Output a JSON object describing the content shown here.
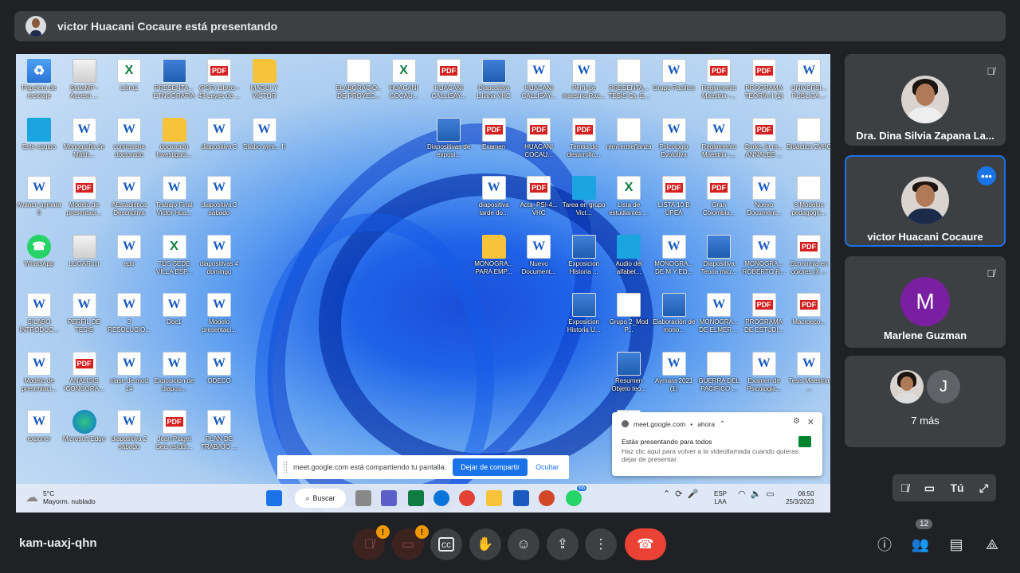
{
  "banner": {
    "text": "victor Huacani Cocaure está presentando"
  },
  "desktop_icons": [
    {
      "label": "Papelera de reciclaje",
      "type": "R"
    },
    {
      "label": "StataMP - Acceso ...",
      "type": "G"
    },
    {
      "label": "Libro1",
      "type": "X"
    },
    {
      "label": "PRESENTA... ETNOGRAFIA",
      "type": "I"
    },
    {
      "label": "(PDF) Libros - 43 Leyes de ...",
      "type": "P"
    },
    {
      "label": "MAGUI Y VICTOR",
      "type": "F"
    },
    {
      "label": "ELABORACIÓ... DE PROYEC...",
      "type": "T"
    },
    {
      "label": "HUACANI COCAU...",
      "type": "X"
    },
    {
      "label": "HUACANI CALLISAY...",
      "type": "P"
    },
    {
      "label": "Diapositiva Liliana VHC",
      "type": "I"
    },
    {
      "label": "HUACANI CALLISAY...",
      "type": "W"
    },
    {
      "label": "Perfil de maestria Rac...",
      "type": "W"
    },
    {
      "label": "PRESENTA... TESIS Cs. E...",
      "type": "T"
    },
    {
      "label": "Grupo Pacifico",
      "type": "W"
    },
    {
      "label": "Reglamento Maestria -...",
      "type": "P"
    },
    {
      "label": "PROGRAMA TEORIA II (1)",
      "type": "P"
    },
    {
      "label": "UNIVERSI... PUBLICA ...",
      "type": "W"
    },
    {
      "label": "Este equipo",
      "type": "C"
    },
    {
      "label": "Monografia de Matth...",
      "type": "W"
    },
    {
      "label": "contrasena doctorado",
      "type": "W"
    },
    {
      "label": "doctorado Investigaci...",
      "type": "F"
    },
    {
      "label": "diapositiva 3",
      "type": "W"
    },
    {
      "label": "Silabo aym... II",
      "type": "W"
    },
    {
      "label": "Diapositivas de exposi...",
      "type": "I"
    },
    {
      "label": "Examen",
      "type": "P"
    },
    {
      "label": "HUACANI COCAU...",
      "type": "P"
    },
    {
      "label": "Temas de desarrollo...",
      "type": "P"
    },
    {
      "label": "remi enseñanza",
      "type": "T"
    },
    {
      "label": "Psicologia Evolutiva",
      "type": "W"
    },
    {
      "label": "Reglamento Maestria -...",
      "type": "W"
    },
    {
      "label": "Burke, la re... ANNALES ...",
      "type": "P"
    },
    {
      "label": "Didáctica 2VHC",
      "type": "T"
    },
    {
      "label": "Avance aymara II",
      "type": "W"
    },
    {
      "label": "Modelo de presentaci...",
      "type": "P"
    },
    {
      "label": "AEstadistica Descriptiva",
      "type": "W"
    },
    {
      "label": "Trabajo Final Victor Hua...",
      "type": "W"
    },
    {
      "label": "diapositiva 3 sabado",
      "type": "W"
    },
    {
      "label": "diapositiva tarde do...",
      "type": "W"
    },
    {
      "label": "Acta_PSI-4... VHC",
      "type": "P"
    },
    {
      "label": "Tarea en grupo Vict...",
      "type": "C"
    },
    {
      "label": "Lista de estudiantes ...",
      "type": "X"
    },
    {
      "label": "LISTA 10 B UPEA",
      "type": "P"
    },
    {
      "label": "Gran Colombia...",
      "type": "P"
    },
    {
      "label": "Nuevo Document...",
      "type": "W"
    },
    {
      "label": "8.Modelos pedagógic...",
      "type": "T"
    },
    {
      "label": "WhatsApp",
      "type": "WA"
    },
    {
      "label": "LUGAR.txt",
      "type": "G"
    },
    {
      "label": "epo",
      "type": "W"
    },
    {
      "label": "TUS SEDE VILLA ESP...",
      "type": "X"
    },
    {
      "label": "diapositivas 4 domingo",
      "type": "W"
    },
    {
      "label": "MONOGRA... PARA EMP...",
      "type": "F"
    },
    {
      "label": "Nuevo Document...",
      "type": "W"
    },
    {
      "label": "Exposicion Historia ...",
      "type": "I"
    },
    {
      "label": "Audio del alfabet...",
      "type": "C"
    },
    {
      "label": "MONOGRA... DE M Y ED...",
      "type": "W"
    },
    {
      "label": "Diapositiva Teoria micr...",
      "type": "I"
    },
    {
      "label": "MONOGRA... ROBERTO R...",
      "type": "W"
    },
    {
      "label": "Economia en colores (X ...",
      "type": "P"
    },
    {
      "label": "SILABO INTRODUC...",
      "type": "W"
    },
    {
      "label": "PERFIL DE TESIS",
      "type": "W"
    },
    {
      "label": "3 RESOLUCIÓ...",
      "type": "W"
    },
    {
      "label": "Doc1",
      "type": "W"
    },
    {
      "label": "Modelo presentaci...",
      "type": "W"
    },
    {
      "label": "Exposicion Historia U...",
      "type": "I"
    },
    {
      "label": "Grupo 2_Mod P...",
      "type": "T"
    },
    {
      "label": "Elaboración de mono...",
      "type": "I"
    },
    {
      "label": "MONOGRA... DE ELMER ...",
      "type": "W"
    },
    {
      "label": "PROGRAMA DE ESTUDI...",
      "type": "P"
    },
    {
      "label": "Macroeco...",
      "type": "P"
    },
    {
      "label": "Modelo de presentaci...",
      "type": "W"
    },
    {
      "label": "ANALISIS ICONOGRA...",
      "type": "P"
    },
    {
      "label": "clase de mod 14",
      "type": "W"
    },
    {
      "label": "Exposicion de diapos...",
      "type": "W"
    },
    {
      "label": "ODECO",
      "type": "W"
    },
    {
      "label": "Resumen Objeto teo...",
      "type": "I"
    },
    {
      "label": "Aymara 2021 (1)",
      "type": "W"
    },
    {
      "label": "GUERRA DEL PACIFICO ...",
      "type": "T"
    },
    {
      "label": "Examen de Psicologia...",
      "type": "W"
    },
    {
      "label": "Tesis Maestria ...",
      "type": "W"
    },
    {
      "label": "exponer",
      "type": "W"
    },
    {
      "label": "Microsoft Edge",
      "type": "E"
    },
    {
      "label": "diapositiva 2 sabado",
      "type": "W"
    },
    {
      "label": "Jean Piaget Seis estudi...",
      "type": "P"
    },
    {
      "label": "PLAN DE TRABAJO ...",
      "type": "W"
    },
    {
      "label": "diap",
      "type": "W"
    }
  ],
  "share_bar": {
    "text": "meet.google.com está compartiendo tu pantalla.",
    "stop": "Dejar de compartir",
    "hide": "Ocultar"
  },
  "notification": {
    "source": "meet.google.com",
    "time": "ahora",
    "title": "Estás presentando para todos",
    "body": "Haz clic aquí para volver a la videollamada cuando quieras dejar de presentar"
  },
  "taskbar": {
    "weather_temp": "5°C",
    "weather_desc": "Mayorm. nublado",
    "search": "Buscar",
    "lang1": "ESP",
    "lang2": "LAA",
    "time": "06:50",
    "date": "25/3/2023",
    "whatsapp_badge": "66"
  },
  "participants": [
    {
      "name": "Dra. Dina Silvia Zapana La..."
    },
    {
      "name": "victor Huacani Cocaure"
    },
    {
      "name": "Marlene Guzman",
      "initial": "M"
    },
    {
      "name": "7 más",
      "initial": "J"
    }
  ],
  "self_view": {
    "label": "Tú"
  },
  "meeting_code": "kam-uaxj-qhn",
  "people_count": "12",
  "colors": {
    "end_call": "#ea4335",
    "accent": "#1a73e8",
    "avatar_purple": "#7b1fa2"
  }
}
